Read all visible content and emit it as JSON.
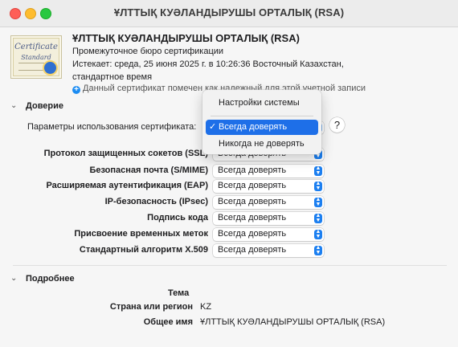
{
  "window": {
    "title": "ҰЛТТЫҚ КУӘЛАНДЫРУШЫ ОРТАЛЫҚ (RSA)"
  },
  "certificate": {
    "icon_title": "Certificate",
    "icon_subtitle": "Standard",
    "name": "ҰЛТТЫҚ КУӘЛАНДЫРУШЫ ОРТАЛЫҚ (RSA)",
    "type": "Промежуточное бюро сертификации",
    "expires": "Истекает: среда, 25 июня 2025 г. в 10:26:36 Восточный Казахстан, стандартное время",
    "trust_status": "Данный сертификат помечен как надежный для этой учетной записи",
    "trust_icon": "plus-circle-icon"
  },
  "trust": {
    "section_label": "Доверие",
    "params_label": "Параметры использования сертификата:",
    "rows": [
      {
        "label": "Протокол защищенных сокетов (SSL)",
        "value": "Всегда доверять"
      },
      {
        "label": "Безопасная почта (S/MIME)",
        "value": "Всегда доверять"
      },
      {
        "label": "Расширяемая аутентификация (EAP)",
        "value": "Всегда доверять"
      },
      {
        "label": "IP-безопасность (IPsec)",
        "value": "Всегда доверять"
      },
      {
        "label": "Подпись кода",
        "value": "Всегда доверять"
      },
      {
        "label": "Присвоение временных меток",
        "value": "Всегда доверять"
      },
      {
        "label": "Стандартный алгоритм X.509",
        "value": "Всегда доверять"
      }
    ],
    "menu": {
      "items": [
        "Настройки системы",
        "Всегда доверять",
        "Никогда не доверять"
      ],
      "selected": "Всегда доверять"
    },
    "help": "?"
  },
  "details": {
    "section_label": "Подробнее",
    "subject_heading": "Тема",
    "fields": [
      {
        "label": "Страна или регион",
        "value": "KZ"
      },
      {
        "label": "Общее имя",
        "value": "ҰЛТТЫҚ КУӘЛАНДЫРУШЫ ОРТАЛЫҚ (RSA)"
      }
    ]
  },
  "colors": {
    "accent": "#1e6fe8",
    "red": "#fe5f57",
    "yellow": "#febc2e",
    "green": "#28c840"
  }
}
